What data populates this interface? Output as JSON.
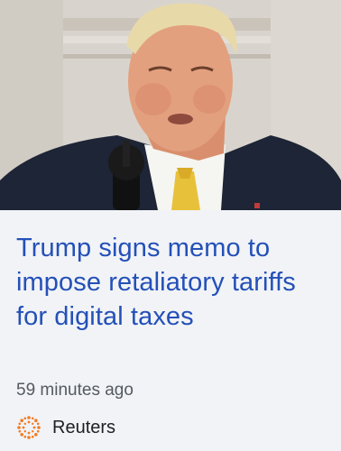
{
  "article": {
    "image_description_icon": "news-photo",
    "headline": "Trump signs memo to impose retaliatory tariffs for digital taxes",
    "timestamp": "59 minutes ago",
    "source": {
      "name": "Reuters",
      "logo_icon": "reuters-logo-icon",
      "logo_color": "#f47b20"
    }
  },
  "colors": {
    "background": "#f1f3f6",
    "headline": "#2450b8",
    "timestamp": "#555a61",
    "source_text": "#202124"
  }
}
